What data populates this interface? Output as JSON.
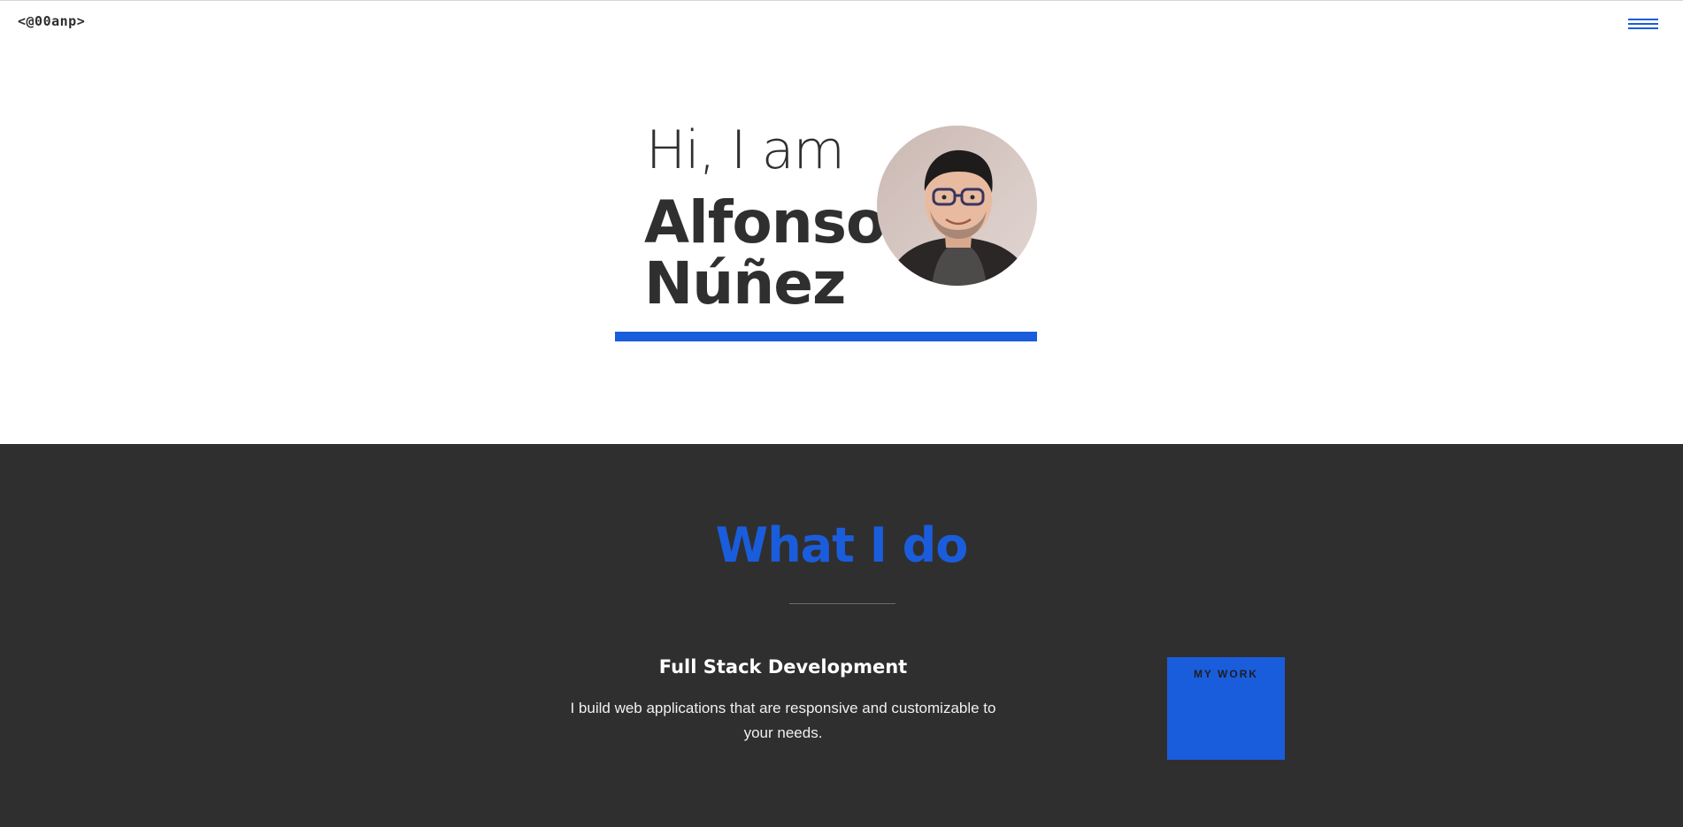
{
  "header": {
    "logo_text": "<@00anp>",
    "menu_icon": "hamburger-menu-icon",
    "accent_color": "#1a5ddc"
  },
  "hero": {
    "greeting": "Hi, I am",
    "first_name": "Alfonso",
    "last_name": "Núñez",
    "photo": "profile-photo"
  },
  "services": {
    "title": "What I do",
    "items": [
      {
        "title": "Full Stack Development",
        "description": "I build web applications that are responsive and customizable to your needs."
      }
    ],
    "cta_label": "MY WORK"
  },
  "colors": {
    "accent": "#1a5ddc",
    "dark_section": "#302f2f",
    "text_dark": "#2f2f2f"
  }
}
